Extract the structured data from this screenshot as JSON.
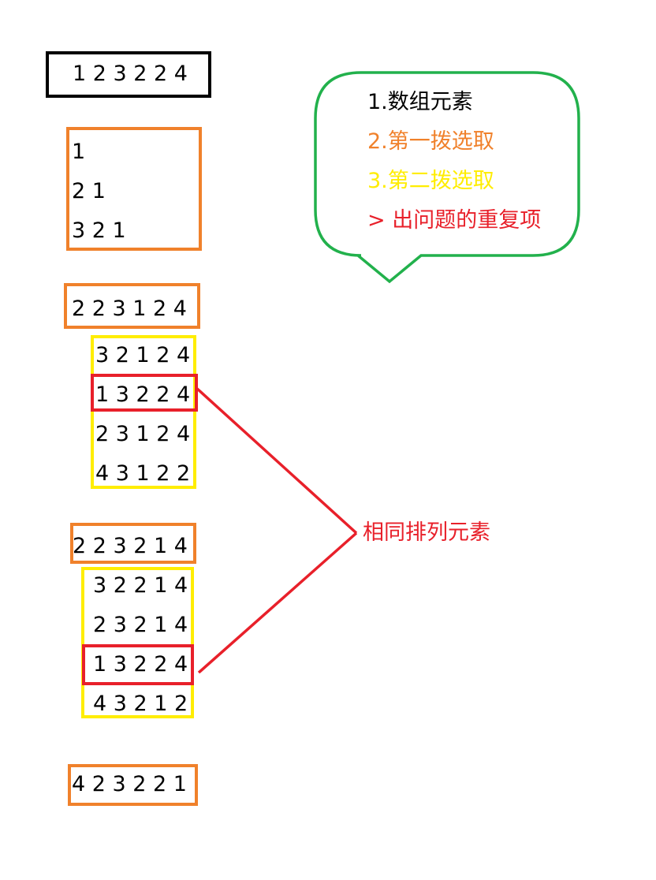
{
  "colors": {
    "black": "#000000",
    "orange": "#f0812b",
    "yellow": "#ffed00",
    "red": "#e8202a",
    "green": "#22b14c"
  },
  "top_array": "1 2 3 2 2 4",
  "first_picks": [
    "1",
    "2 1",
    "3 2 1"
  ],
  "group1": {
    "first": "2 2 3 1 2 4",
    "second": [
      "3 2 1 2 4",
      "1 3 2 2 4",
      "2 3 1 2 4",
      "4 3 1 2 2"
    ]
  },
  "group2": {
    "first": "2 2 3 2 1 4",
    "second": [
      "3 2 2 1 4",
      "2 3 2 1 4",
      "1 3 2 2 4",
      "4 3 2 1 2"
    ]
  },
  "group3": {
    "first": "4 2 3 2 2 1"
  },
  "legend": {
    "items": [
      "1.数组元素",
      "2.第一拨选取",
      "3.第二拨选取",
      "> 出问题的重复项"
    ]
  },
  "annotation": "相同排列元素"
}
